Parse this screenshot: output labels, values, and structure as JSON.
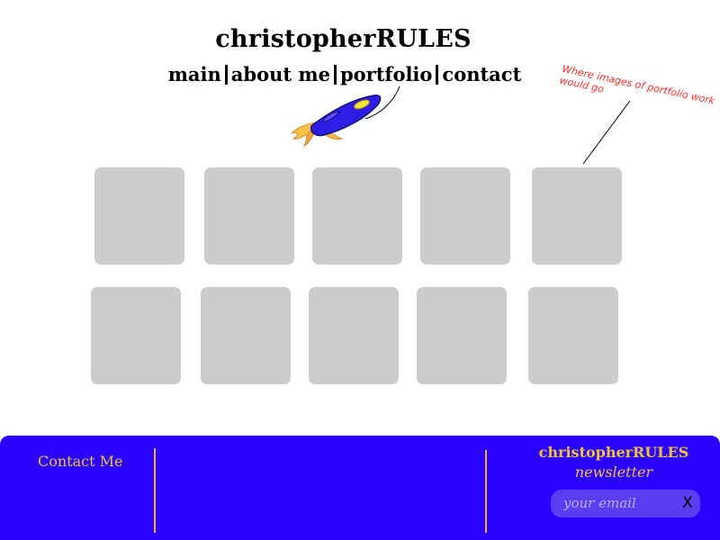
{
  "header": {
    "site_title": "christopherRULES",
    "nav": [
      {
        "label": "main"
      },
      {
        "label": "about me"
      },
      {
        "label": "portfolio"
      },
      {
        "label": "contact"
      }
    ]
  },
  "annotation": {
    "text": "Where images of portfolio work would go",
    "color": "#ff2a2a"
  },
  "portfolio": {
    "thumbnail_count": 10,
    "thumbnail_color": "#cccccc"
  },
  "footer": {
    "background": "#2a00ff",
    "accent": "#f0c23a",
    "contact_label": "Contact Me",
    "newsletter": {
      "title": "christopherRULES",
      "subtitle": "newsletter",
      "email_placeholder": "your email",
      "close_label": "X"
    }
  }
}
